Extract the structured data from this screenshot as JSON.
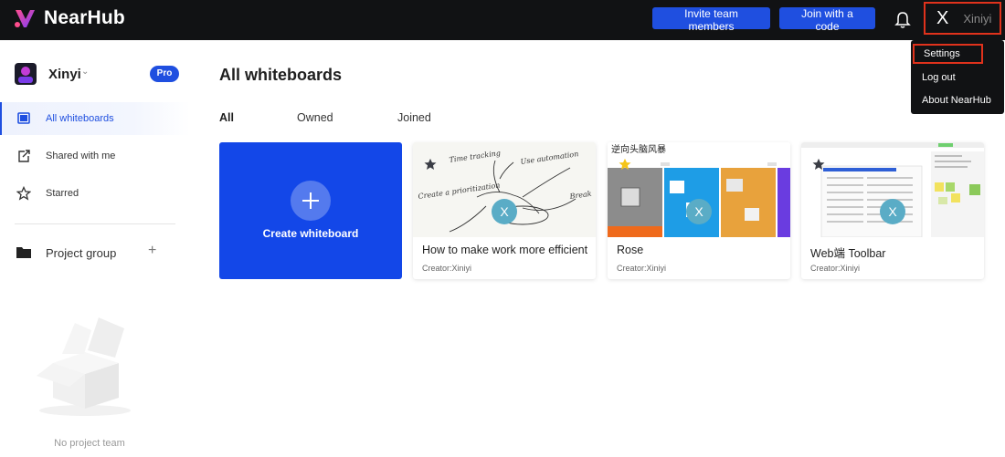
{
  "header": {
    "logo_text": "NearHub",
    "invite_label": "Invite team members",
    "join_label": "Join with a code",
    "user_initial": "X",
    "user_name": "Xiniyi",
    "colors": {
      "bar": "#111214",
      "accent": "#1f4fe0",
      "highlight": "#e0321c"
    }
  },
  "dropdown": {
    "items": [
      {
        "label": "Settings"
      },
      {
        "label": "Log out"
      },
      {
        "label": "About NearHub"
      }
    ]
  },
  "sidebar": {
    "workspace_name": "Xinyi",
    "pro_badge": "Pro",
    "nav": [
      {
        "label": "All whiteboards",
        "icon": "whiteboard-icon"
      },
      {
        "label": "Shared with me",
        "icon": "share-icon"
      },
      {
        "label": "Starred",
        "icon": "star-icon"
      }
    ],
    "project_group_label": "Project group",
    "empty_text": "No project team"
  },
  "main": {
    "title": "All whiteboards",
    "tabs": [
      {
        "label": "All"
      },
      {
        "label": "Owned"
      },
      {
        "label": "Joined"
      }
    ],
    "create_label": "Create whiteboard",
    "boards": [
      {
        "title": "How to make work more efficient",
        "creator": "Creator:Xiniyi",
        "avatar": "X"
      },
      {
        "title": "Rose",
        "creator": "Creator:Xiniyi",
        "avatar": "X",
        "thumb_caption": "逆向头脑风暴"
      },
      {
        "title": "Web端 Toolbar",
        "creator": "Creator:Xiniyi",
        "avatar": "X"
      }
    ],
    "sketch_words": [
      "Time tracking",
      "Use automation",
      "Create a prioritization",
      "Break"
    ]
  }
}
